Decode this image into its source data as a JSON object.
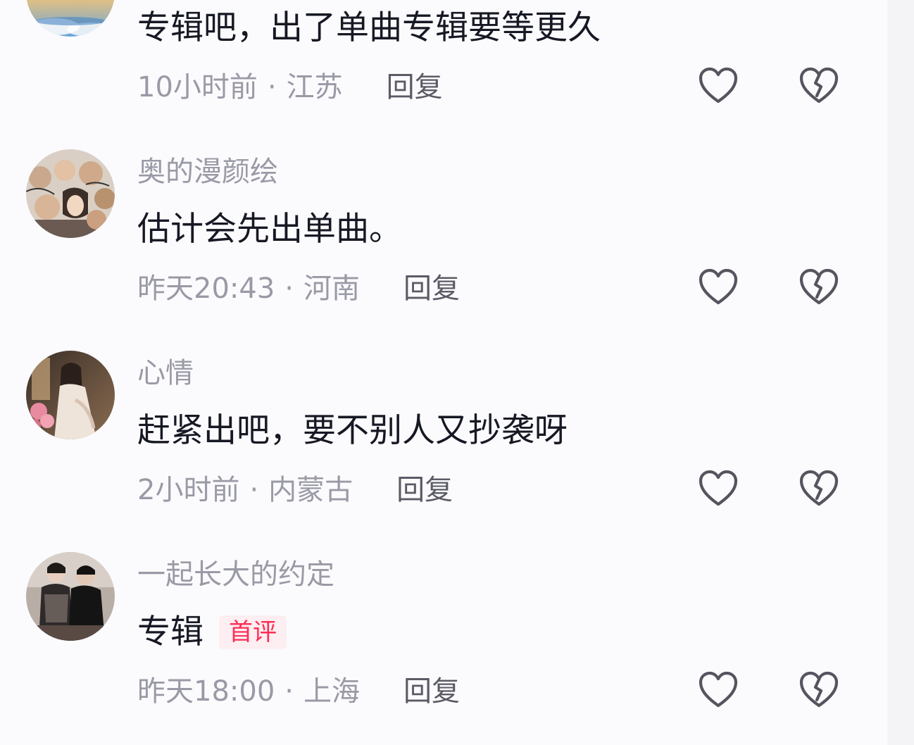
{
  "comments": [
    {
      "username": "",
      "text": "专辑吧，出了单曲专辑要等更久",
      "time": "10小时前",
      "location": "江苏",
      "reply_label": "回复",
      "badge": ""
    },
    {
      "username": "奥的漫颜绘",
      "text": "估计会先出单曲。",
      "time": "昨天20:43",
      "location": "河南",
      "reply_label": "回复",
      "badge": ""
    },
    {
      "username": "心情",
      "text": "赶紧出吧，要不别人又抄袭呀",
      "time": "2小时前",
      "location": "内蒙古",
      "reply_label": "回复",
      "badge": ""
    },
    {
      "username": "一起长大的约定",
      "text": "专辑",
      "time": "昨天18:00",
      "location": "上海",
      "reply_label": "回复",
      "badge": "首评"
    }
  ],
  "separator": "·",
  "icons": {
    "like": "heart-outline-icon",
    "dislike": "broken-heart-icon"
  },
  "colors": {
    "text": "#161823",
    "secondary": "#9a9aa6",
    "reply": "#5b5b66",
    "badge_text": "#fe2c55",
    "badge_bg": "#fdeef1",
    "icon_stroke": "#55555f"
  }
}
